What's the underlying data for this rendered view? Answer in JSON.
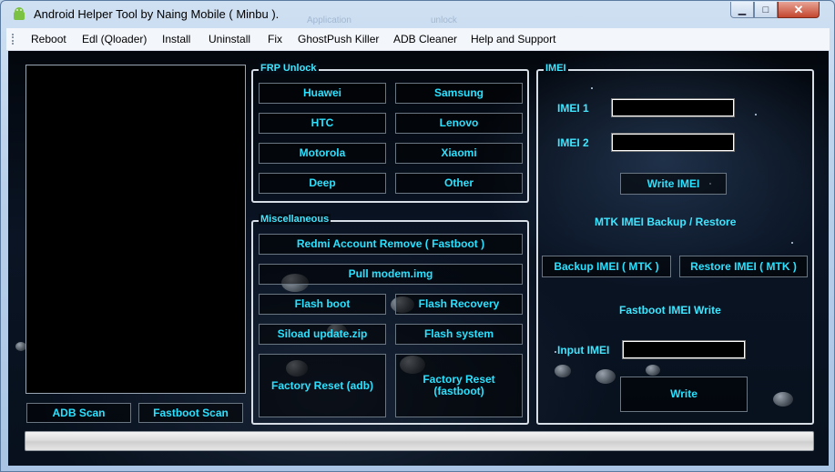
{
  "window": {
    "title": "Android Helper Tool by Naing Mobile ( Minbu ).",
    "ghost_texts": [
      "Application",
      "unlock"
    ],
    "controls": {
      "minimize": "▁",
      "maximize": "□",
      "close": "✕"
    }
  },
  "menu": [
    "Reboot",
    "Edl (Qloader)",
    "Install",
    "Uninstall",
    "Fix",
    "GhostPush Killer",
    "ADB Cleaner",
    "Help and Support"
  ],
  "left": {
    "adb_scan": "ADB Scan",
    "fastboot_scan": "Fastboot Scan"
  },
  "frp": {
    "legend": "FRP Unlock",
    "buttons": [
      "Huawei",
      "Samsung",
      "HTC",
      "Lenovo",
      "Motorola",
      "Xiaomi",
      "Deep",
      "Other"
    ]
  },
  "misc": {
    "legend": "Miscellaneous",
    "redmi": "Redmi Account Remove ( Fastboot )",
    "pull_modem": "Pull modem.img",
    "flash_boot": "Flash boot",
    "flash_recovery": "Flash Recovery",
    "siload": "Siload update.zip",
    "flash_system": "Flash system",
    "factory_adb": "Factory Reset (adb)",
    "factory_fastboot": "Factory Reset (fastboot)"
  },
  "imei": {
    "legend": "IMEI",
    "imei1_label": "IMEI 1",
    "imei2_label": "IMEI 2",
    "imei1_value": "",
    "imei2_value": "",
    "write_imei": "Write IMEI",
    "mtk_title": "MTK IMEI Backup / Restore",
    "backup": "Backup IMEI ( MTK )",
    "restore": "Restore IMEI ( MTK )",
    "fastboot_title": "Fastboot IMEI Write",
    "input_label": "Input IMEI",
    "input_value": "",
    "write": "Write"
  },
  "progress": {
    "value": 0
  }
}
